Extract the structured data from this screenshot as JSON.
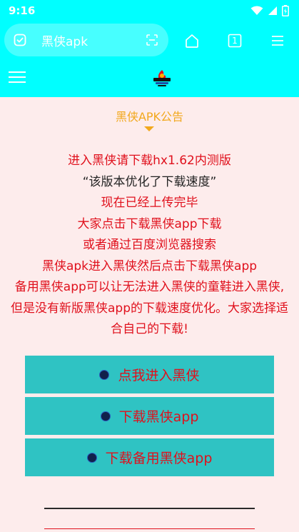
{
  "status": {
    "time": "9:16",
    "icons": [
      "wifi-icon",
      "signal-icon",
      "battery-icon"
    ]
  },
  "browser": {
    "url": "黑侠apk",
    "tab_count": "1",
    "icons": [
      "shield-check-icon",
      "scan-icon",
      "home-icon",
      "tabs-icon",
      "menu-icon"
    ]
  },
  "site": {
    "icons": [
      "hamburger-icon",
      "logo-icon"
    ]
  },
  "notice": {
    "title": "黑侠APK公告",
    "lines": [
      "进入黑侠请下载hx1.62内测版",
      "“该版本优化了下载速度”",
      "现在已经上传完毕",
      "大家点击下载黑侠app下载",
      "或者通过百度浏览器搜索",
      "黑侠apk进入黑侠然后点击下载黑侠app",
      "备用黑侠app可以让无法进入黑侠的童鞋进入黑侠,但是没有新版黑侠app的下载速度优化。大家选择适合自己的下载!"
    ]
  },
  "buttons": {
    "enter": "点我进入黑侠",
    "download": "下载黑侠app",
    "download_backup": "下载备用黑侠app"
  },
  "colors": {
    "accent": "#00ffff",
    "button_bg": "#2fc3c3",
    "text_red": "#e0101c",
    "title_orange": "#f2a81d",
    "page_bg": "#fdecec"
  }
}
